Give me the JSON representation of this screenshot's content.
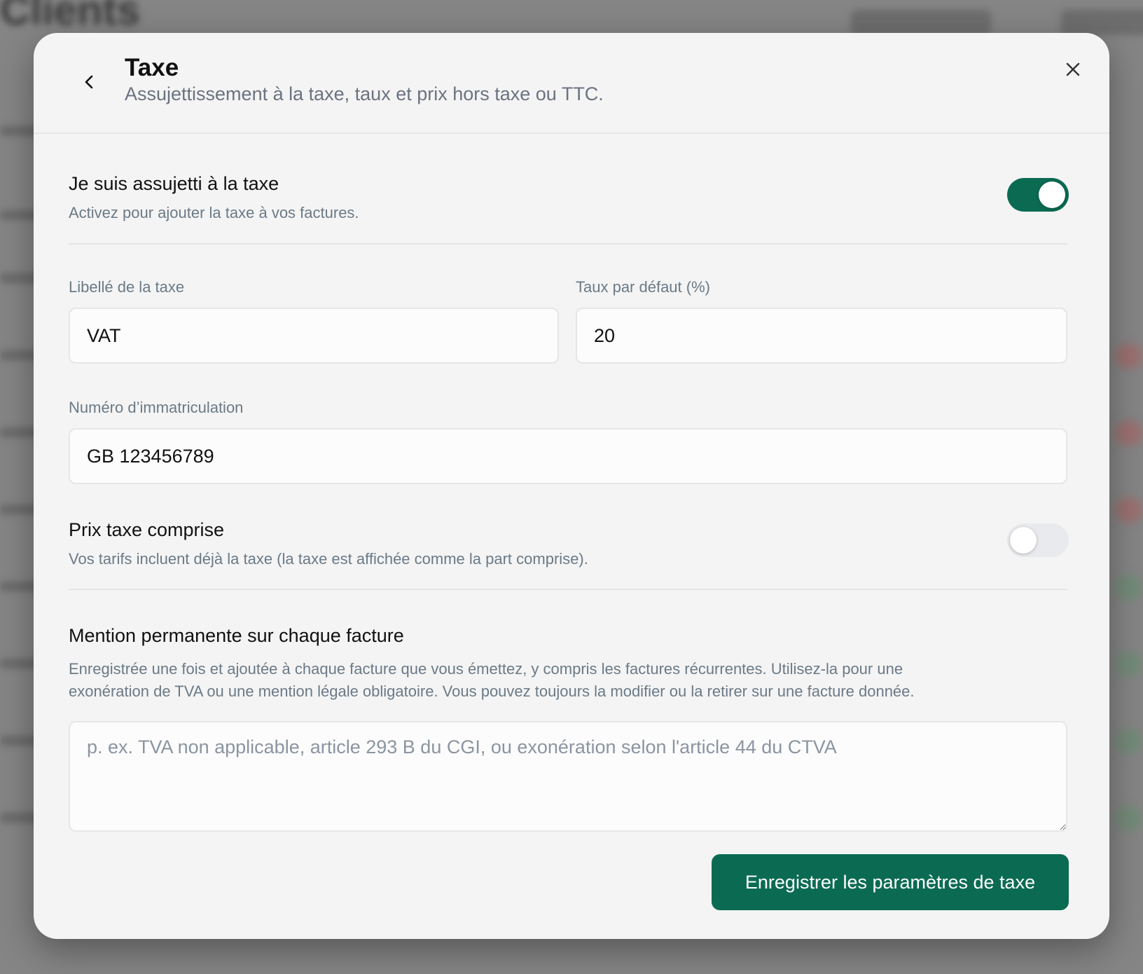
{
  "background": {
    "app_title": "Clients"
  },
  "modal": {
    "title": "Taxe",
    "subtitle": "Assujettissement à la taxe, taux et prix hors taxe ou TTC.",
    "back_icon": "chevron-left-icon",
    "close_icon": "close-icon"
  },
  "tax_liable": {
    "title": "Je suis assujetti à la taxe",
    "description": "Activez pour ajouter la taxe à vos factures.",
    "enabled": true
  },
  "tax_label": {
    "label": "Libellé de la taxe",
    "value": "VAT"
  },
  "default_rate": {
    "label": "Taux par défaut (%)",
    "value": "20"
  },
  "registration_number": {
    "label": "Numéro d’immatriculation",
    "value": "GB 123456789"
  },
  "tax_inclusive": {
    "title": "Prix taxe comprise",
    "description": "Vos tarifs incluent déjà la taxe (la taxe est affichée comme la part comprise).",
    "enabled": false
  },
  "permanent_mention": {
    "title": "Mention permanente sur chaque facture",
    "description_line1": "Enregistrée une fois et ajoutée à chaque facture que vous émettez, y compris les factures récurrentes. Utilisez-la pour une",
    "description_line2": "exonération de TVA ou une mention légale obligatoire. Vous pouvez toujours la modifier ou la retirer sur une facture donnée.",
    "placeholder": "p. ex. TVA non applicable, article 293 B du CGI, ou exonération selon l'article 44 du CTVA",
    "value": ""
  },
  "save_button": {
    "label": "Enregistrer les paramètres de taxe"
  },
  "colors": {
    "accent": "#0b6b52",
    "modal_background": "#f4f4f4",
    "muted_text": "#6b7a87"
  }
}
